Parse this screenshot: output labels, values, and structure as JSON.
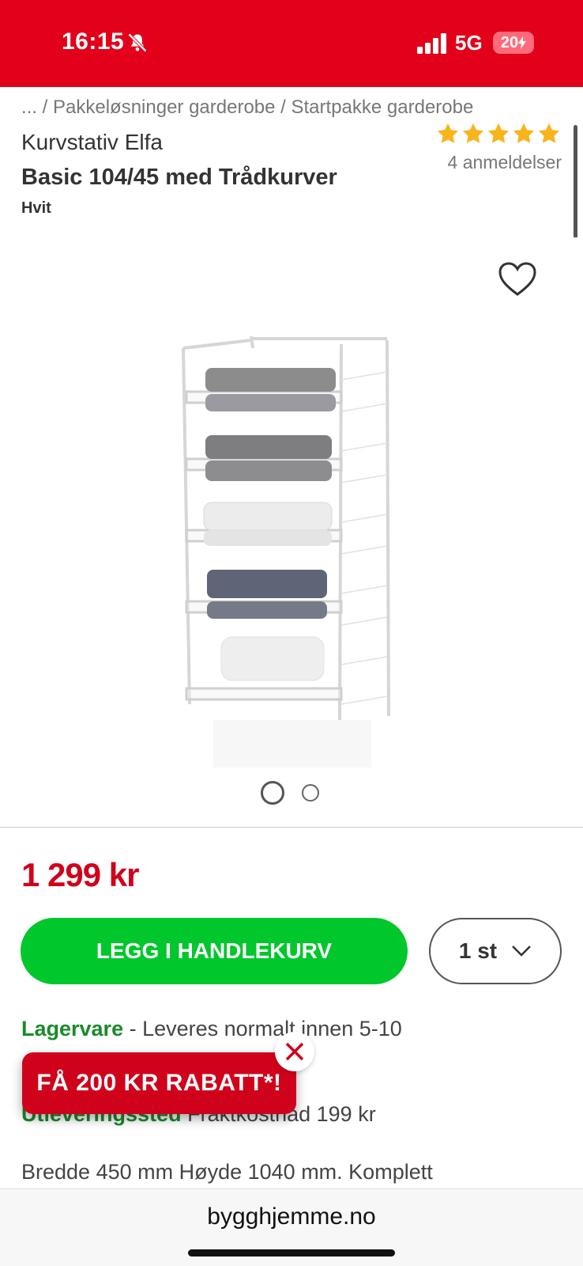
{
  "status_bar": {
    "time": "16:15",
    "network": "5G",
    "battery": "20",
    "icons": [
      "bell-muted-icon",
      "signal-icon",
      "battery-charging-icon"
    ],
    "background_color": "#e2001a"
  },
  "breadcrumb": "... / Pakkeløsninger garderobe / Startpakke garderobe",
  "product": {
    "brand": "Kurvstativ Elfa",
    "title": "Basic 104/45 med Trådkurver",
    "variant": "Hvit",
    "rating": 5,
    "reviews_label": "4 anmeldelser",
    "star_color": "#f8b41c"
  },
  "gallery": {
    "image_count": 2,
    "active_index": 0
  },
  "purchase": {
    "price": "1 299 kr",
    "price_color": "#d0021b",
    "add_to_cart_label": "LEGG I HANDLEKURV",
    "add_to_cart_color": "#00c72b",
    "quantity_label": "1 st"
  },
  "delivery": {
    "stock_label": "Lagervare",
    "stock_text": " - Leveres normalt innen 5-10",
    "pickup_label": "Utleveringssted",
    "pickup_text": " Fraktkostnad 199 kr",
    "status_color": "#1a8a2a"
  },
  "description": "Bredde 450 mm Høyde 1040 mm. Komplett",
  "promo": {
    "label": "FÅ 200 KR RABATT*!"
  },
  "url_bar": {
    "domain": "bygghjemme.no"
  }
}
